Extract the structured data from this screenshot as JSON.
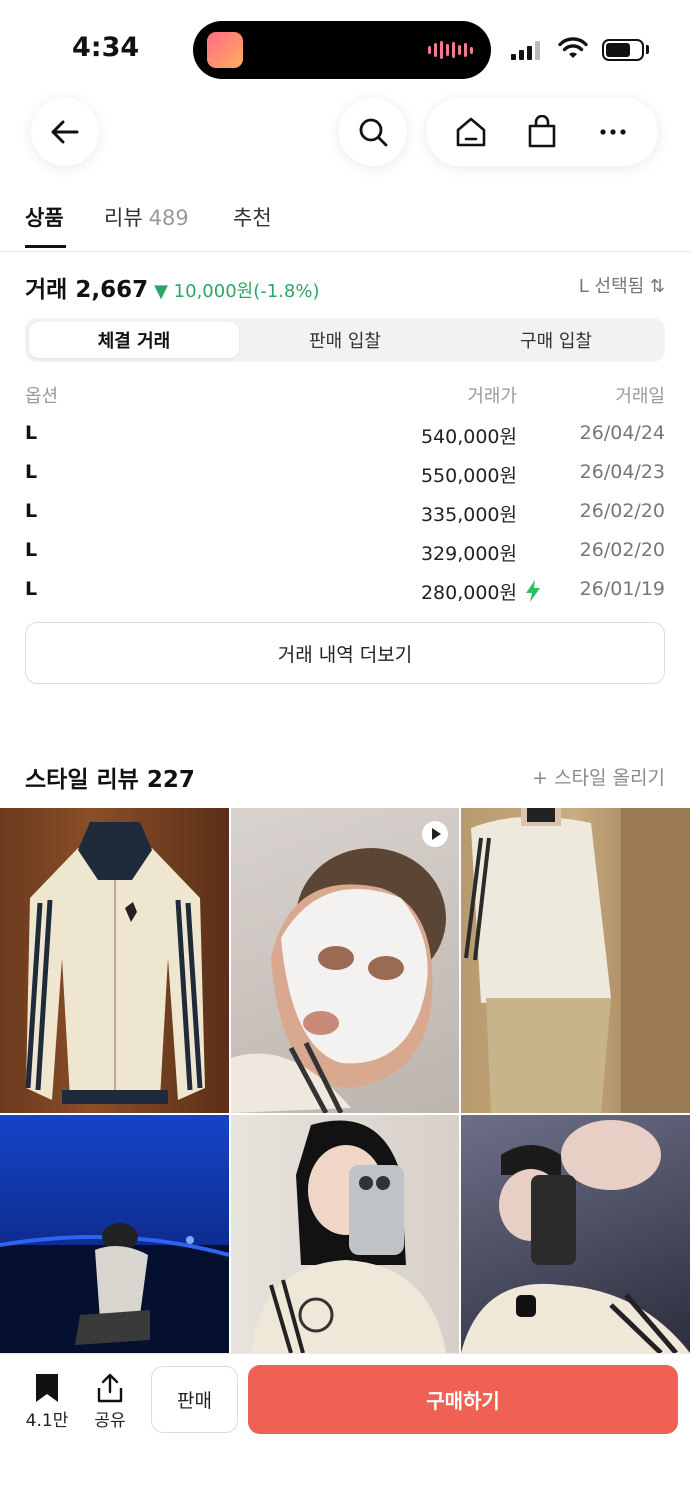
{
  "status_bar": {
    "time": "4:34"
  },
  "tabs": [
    {
      "label": "상품",
      "count": ""
    },
    {
      "label": "리뷰",
      "count": "489"
    },
    {
      "label": "추천",
      "count": ""
    }
  ],
  "trade": {
    "title": "거래 2,667",
    "delta": "▼ 10,000원(-1.8%)",
    "delta_color": "#2aa765",
    "size_selected": "L 선택됨 ⇅"
  },
  "segments": [
    "체결 거래",
    "판매 입찰",
    "구매 입찰"
  ],
  "table": {
    "headers": {
      "option": "옵션",
      "price": "거래가",
      "date": "거래일"
    },
    "rows": [
      {
        "option": "L",
        "price": "540,000원",
        "date": "26/04/24",
        "quick": false
      },
      {
        "option": "L",
        "price": "550,000원",
        "date": "26/04/23",
        "quick": false
      },
      {
        "option": "L",
        "price": "335,000원",
        "date": "26/02/20",
        "quick": false
      },
      {
        "option": "L",
        "price": "329,000원",
        "date": "26/02/20",
        "quick": false
      },
      {
        "option": "L",
        "price": "280,000원",
        "date": "26/01/19",
        "quick": true
      }
    ]
  },
  "more_button": "거래 내역 더보기",
  "style_review": {
    "title": "스타일 리뷰 227",
    "upload": "+ 스타일 올리기"
  },
  "bottom": {
    "bookmark_count": "4.1만",
    "share": "공유",
    "sell": "판매",
    "buy": "구매하기",
    "buy_color": "#ef6253"
  }
}
